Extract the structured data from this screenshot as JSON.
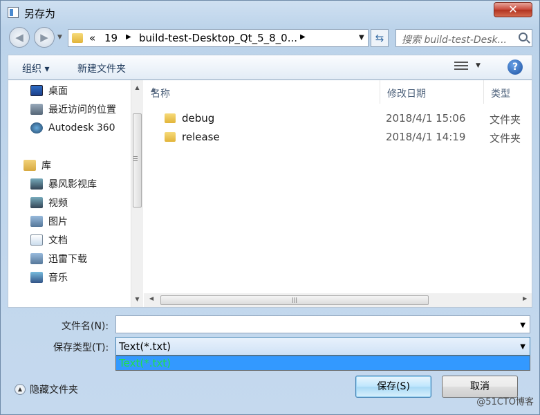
{
  "window": {
    "title": "另存为",
    "close_glyph": "✕"
  },
  "nav": {
    "breadcrumb": [
      "«",
      "19",
      "build-test-Desktop_Qt_5_8_0..."
    ],
    "search_placeholder": "搜索 build-test-Desk..."
  },
  "toolbar": {
    "organize": "组织 ▾",
    "new_folder": "新建文件夹",
    "help": "?"
  },
  "sidebar": {
    "items": [
      {
        "label": "桌面",
        "icon": "desktop-icon"
      },
      {
        "label": "最近访问的位置",
        "icon": "recent-places-icon"
      },
      {
        "label": "Autodesk 360",
        "icon": "autodesk-icon"
      },
      {
        "label": "库",
        "icon": "library-icon"
      },
      {
        "label": "暴风影视库",
        "icon": "video-library-icon"
      },
      {
        "label": "视频",
        "icon": "video-icon"
      },
      {
        "label": "图片",
        "icon": "picture-icon"
      },
      {
        "label": "文档",
        "icon": "document-icon"
      },
      {
        "label": "迅雷下载",
        "icon": "download-icon"
      },
      {
        "label": "音乐",
        "icon": "music-icon"
      }
    ]
  },
  "file_list": {
    "columns": [
      "名称",
      "修改日期",
      "类型"
    ],
    "rows": [
      {
        "name": "debug",
        "date": "2018/4/1 15:06",
        "type": "文件夹"
      },
      {
        "name": "release",
        "date": "2018/4/1 14:19",
        "type": "文件夹"
      }
    ]
  },
  "form": {
    "filename_label": "文件名(N):",
    "filename_value": "",
    "filetype_label": "保存类型(T):",
    "filetype_value": "Text(*.txt)",
    "filetype_options": [
      "Text(*.txt)"
    ]
  },
  "footer": {
    "hide_folders": "隐藏文件夹",
    "save": "保存(S)",
    "cancel": "取消",
    "watermark": "@51CTO博客"
  }
}
